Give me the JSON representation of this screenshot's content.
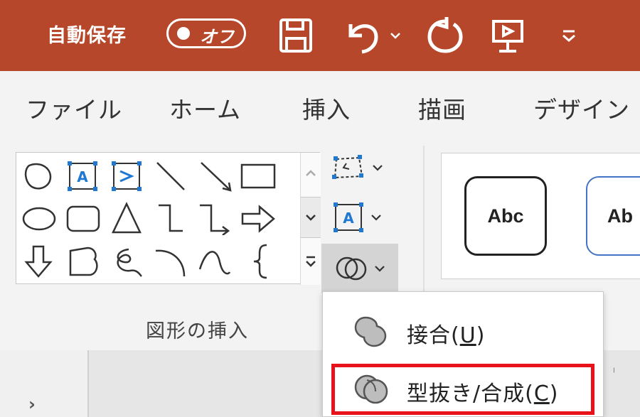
{
  "titlebar": {
    "autosave_label": "自動保存",
    "autosave_state": "オフ",
    "quick_access": [
      "save-icon",
      "undo-icon",
      "redo-icon",
      "present-icon",
      "customize-icon"
    ]
  },
  "menu": {
    "tabs": [
      "ファイル",
      "ホーム",
      "挿入",
      "描画",
      "デザイン"
    ]
  },
  "ribbon": {
    "group_label": "図形の挿入",
    "styles": [
      "Abc",
      "Ab"
    ]
  },
  "dropdown": {
    "items": [
      {
        "label": "接合",
        "mnemonic": "U"
      },
      {
        "label": "型抜き/合成",
        "mnemonic": "C"
      }
    ]
  },
  "colors": {
    "titlebar": "#b7472a",
    "highlight": "#e8121b",
    "accent_blue": "#1f78d1"
  }
}
